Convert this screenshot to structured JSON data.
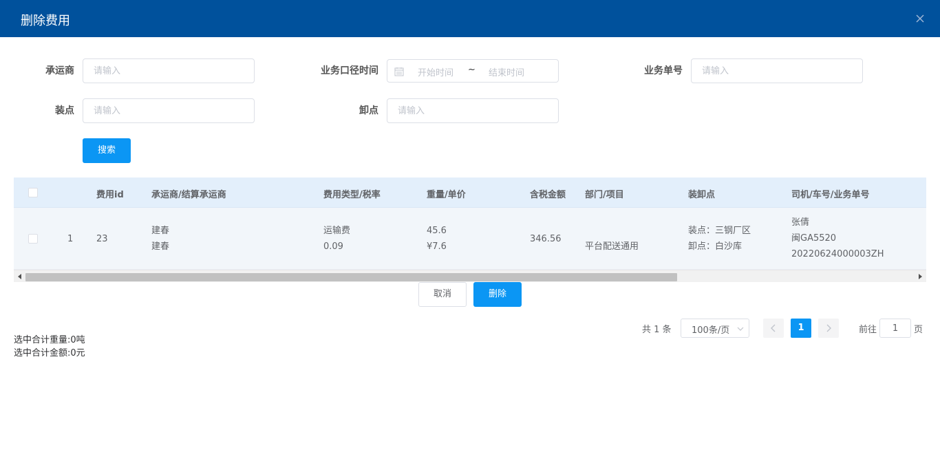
{
  "dialog": {
    "title": "删除费用"
  },
  "filters": {
    "carrier_label": "承运商",
    "carrier_placeholder": "请输入",
    "biz_time_label": "业务口径时间",
    "start_placeholder": "开始时间",
    "range_separator": "~",
    "end_placeholder": "结束时间",
    "biz_no_label": "业务单号",
    "biz_no_placeholder": "请输入",
    "load_label": "装点",
    "load_placeholder": "请输入",
    "unload_label": "卸点",
    "unload_placeholder": "请输入",
    "search_button": "搜索"
  },
  "table": {
    "headers": [
      "费用id",
      "承运商/结算承运商",
      "费用类型/税率",
      "重量/单价",
      "含税金额",
      "部门/项目",
      "装卸点",
      "司机/车号/业务单号"
    ],
    "rows": [
      {
        "index": "1",
        "fee_id": "23",
        "carrier": "建春",
        "settle_carrier": "建春",
        "fee_type": "运输费",
        "tax_rate": "0.09",
        "weight": "45.6",
        "unit_price": "¥7.6",
        "amount": "346.56",
        "dept_project": "平台配送通用",
        "load_point": "装点：三钢厂区",
        "unload_point": "卸点：白沙库",
        "driver": "张倩",
        "plate": "闽GA5520",
        "biz_no": "20220624000003ZH"
      }
    ]
  },
  "actions": {
    "cancel": "取消",
    "delete": "删除"
  },
  "summary": {
    "weight": "选中合计重量:0吨",
    "amount": "选中合计金额:0元"
  },
  "pagination": {
    "total": "共 1 条",
    "page_size": "100条/页",
    "current_page": "1",
    "goto_label": "前往",
    "goto_value": "1",
    "goto_unit": "页"
  },
  "colors": {
    "header_bg": "#00519c",
    "primary": "#0b96f4",
    "table_header_bg": "#e3effb"
  }
}
